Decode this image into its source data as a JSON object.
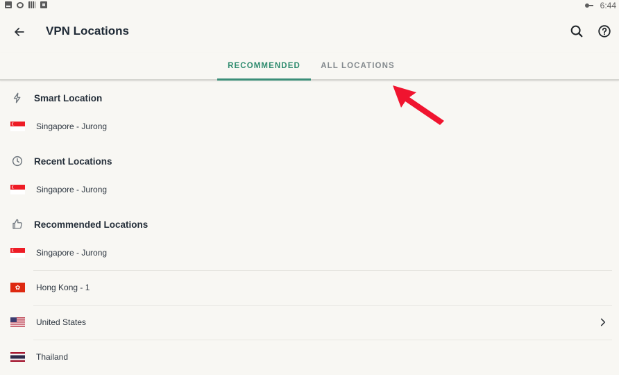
{
  "status_bar": {
    "left_icons": [
      "image-icon",
      "sync-icon",
      "chart-icon",
      "box-icon"
    ],
    "right_icons": [
      "vpn-key-icon"
    ],
    "time": "6:44"
  },
  "app_bar": {
    "title": "VPN Locations",
    "back_icon": "arrow-left-icon",
    "actions": [
      {
        "name": "search",
        "icon": "search-icon"
      },
      {
        "name": "help",
        "icon": "help-circle-icon"
      }
    ]
  },
  "tabs": [
    {
      "label": "RECOMMENDED",
      "active": true
    },
    {
      "label": "ALL LOCATIONS",
      "active": false
    }
  ],
  "sections": {
    "smart": {
      "title": "Smart Location",
      "icon": "lightning-icon",
      "items": [
        {
          "label": "Singapore - Jurong",
          "flag": "SG"
        }
      ]
    },
    "recent": {
      "title": "Recent Locations",
      "icon": "clock-icon",
      "items": [
        {
          "label": "Singapore - Jurong",
          "flag": "SG"
        }
      ]
    },
    "recommended": {
      "title": "Recommended Locations",
      "icon": "thumbs-up-icon",
      "items": [
        {
          "label": "Singapore - Jurong",
          "flag": "SG",
          "expandable": false
        },
        {
          "label": "Hong Kong - 1",
          "flag": "HK",
          "expandable": false
        },
        {
          "label": "United States",
          "flag": "US",
          "expandable": true
        },
        {
          "label": "Thailand",
          "flag": "TH",
          "expandable": false
        }
      ]
    }
  },
  "colors": {
    "accent": "#3b8e78",
    "background": "#f8f7f3",
    "annotation_arrow": "#f0142f"
  },
  "annotation": {
    "type": "arrow",
    "points_to": "ALL LOCATIONS"
  }
}
